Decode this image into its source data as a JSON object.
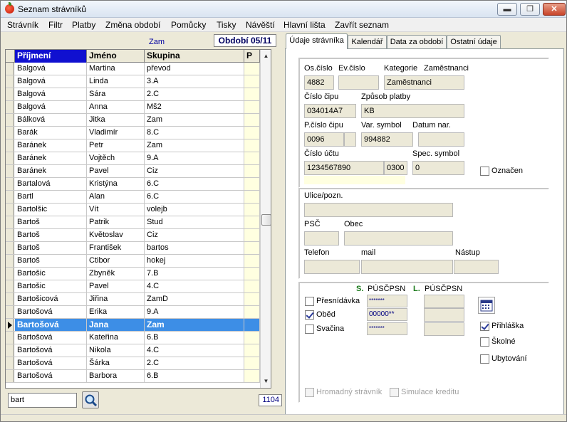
{
  "window": {
    "title": "Seznam strávníků",
    "btn_min": "▬",
    "btn_max": "❐",
    "btn_close": "✕"
  },
  "menu": [
    "Strávník",
    "Filtr",
    "Platby",
    "Změna období",
    "Pomůcky",
    "Tisky",
    "Návěští",
    "Hlavní lišta",
    "Zavřít seznam"
  ],
  "period": {
    "label": "Zam",
    "value": "Období 05/11"
  },
  "grid": {
    "columns": [
      "Příjmení",
      "Jméno",
      "Skupina",
      "P"
    ],
    "rows": [
      [
        "Balgová",
        "Martina",
        "převod"
      ],
      [
        "Balgová",
        "Linda",
        "3.A"
      ],
      [
        "Balgová",
        "Sára",
        "2.C"
      ],
      [
        "Balgová",
        "Anna",
        "Mš2"
      ],
      [
        "Bálková",
        "Jitka",
        "Zam"
      ],
      [
        "Barák",
        "Vladimír",
        "8.C"
      ],
      [
        "Baránek",
        "Petr",
        "Zam"
      ],
      [
        "Baránek",
        "Vojtěch",
        "9.A"
      ],
      [
        "Baránek",
        "Pavel",
        "Ciz"
      ],
      [
        "Bartalová",
        "Kristýna",
        "6.C"
      ],
      [
        "Bartl",
        "Alan",
        "6.C"
      ],
      [
        "Bartolšic",
        "Vít",
        "volejb"
      ],
      [
        "Bartoš",
        "Patrik",
        "Stud"
      ],
      [
        "Bartoš",
        "Květoslav",
        "Ciz"
      ],
      [
        "Bartoš",
        "František",
        "bartos"
      ],
      [
        "Bartoš",
        "Ctibor",
        "hokej"
      ],
      [
        "Bartošic",
        "Zbyněk",
        "7.B"
      ],
      [
        "Bartošic",
        "Pavel",
        "4.C"
      ],
      [
        "Bartošicová",
        "Jiřina",
        "ZamD"
      ],
      [
        "Bartošová",
        "Erika",
        "9.A"
      ],
      [
        "Bartošová",
        "Jana",
        "Zam"
      ],
      [
        "Bartošová",
        "Kateřina",
        "6.B"
      ],
      [
        "Bartošová",
        "Nikola",
        "4.C"
      ],
      [
        "Bartošová",
        "Šárka",
        "2.C"
      ],
      [
        "Bartošová",
        "Barbora",
        "6.B"
      ]
    ],
    "selected_index": 20,
    "scroll_up": "▲",
    "scroll_down": "▼"
  },
  "search": {
    "value": "bart",
    "count": "1104"
  },
  "tabs": [
    "Údaje strávníka",
    "Kalendář",
    "Data za období",
    "Ostatní údaje"
  ],
  "details": {
    "os_cislo_label": "Os.číslo",
    "os_cislo": "4882",
    "ev_cislo_label": "Ev.číslo",
    "ev_cislo": "",
    "kategorie_label": "Kategorie",
    "kategorie_value_label": "Zaměstnanci",
    "kategorie": "Zaměstnanci",
    "cislo_cipu_label": "Číslo čipu",
    "cislo_cipu": "034014A7",
    "zpusob_platby_label": "Způsob platby",
    "zpusob_platby": "KB",
    "p_cislo_cipu_label": "P.číslo čipu",
    "p_cislo_cipu": "0096",
    "var_symbol_label": "Var. symbol",
    "var_symbol": "994882",
    "datum_nar_label": "Datum nar.",
    "datum_nar": "",
    "cislo_uctu_label": "Číslo účtu",
    "cislo_uctu": "1234567890",
    "kod_banky": "0300",
    "spec_symbol_label": "Spec. symbol",
    "spec_symbol": "0",
    "oznacen_label": "Označen",
    "ulice_label": "Ulice/pozn.",
    "psc_label": "PSČ",
    "obec_label": "Obec",
    "telefon_label": "Telefon",
    "mail_label": "mail",
    "nastup_label": "Nástup"
  },
  "meals": {
    "s_label": "S.",
    "l_label": "L.",
    "puscpsn": "PÚSČPSN",
    "items": [
      {
        "label": "Přesnídávka",
        "checked": false,
        "code": "*******"
      },
      {
        "label": "Oběd",
        "checked": true,
        "code": "00000**"
      },
      {
        "label": "Svačina",
        "checked": false,
        "code": "*******"
      }
    ],
    "prihlaska": "Přihláška",
    "skolne": "Školné",
    "ubytovani": "Ubytování",
    "hromadny": "Hromadný strávník",
    "simulace": "Simulace kreditu"
  },
  "colors": {
    "selection": "#3d8ee6",
    "p_column": "#ffffe0",
    "group_label": "#1a7a1a"
  }
}
